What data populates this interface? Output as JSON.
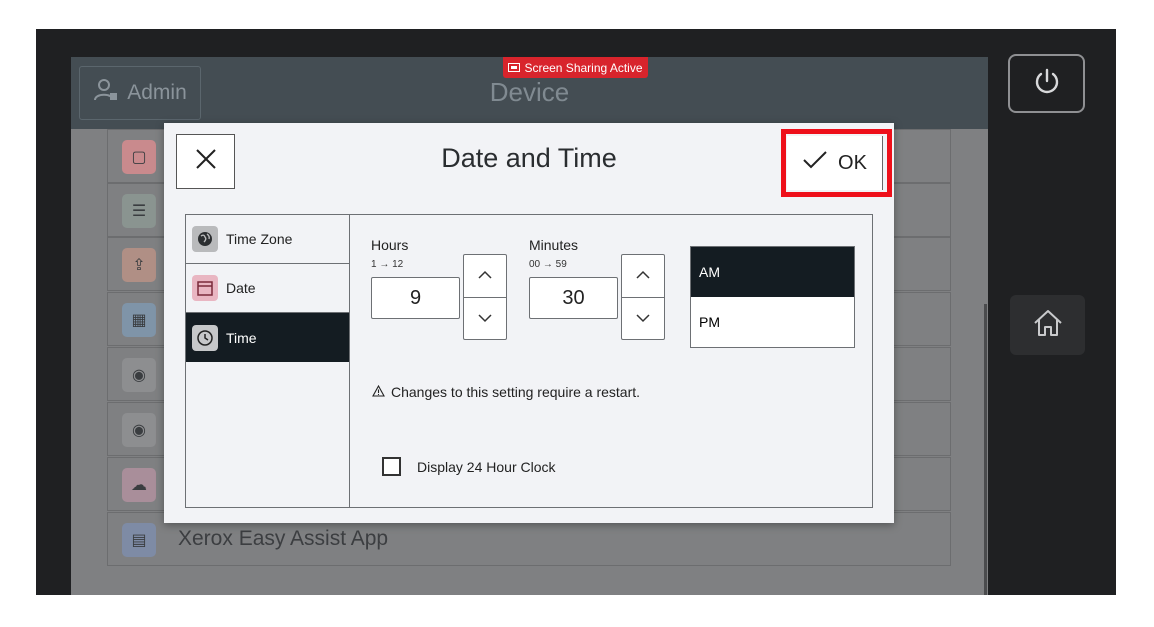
{
  "header": {
    "admin_label": "Admin",
    "title": "Device",
    "screen_share_badge": "Screen Sharing Active"
  },
  "background_list": {
    "rows": [
      {
        "label": "",
        "icon": "app-icon",
        "color": "#c98a8d"
      },
      {
        "label": "",
        "icon": "list-icon",
        "color": "#8a9490"
      },
      {
        "label": "",
        "icon": "upload-box-icon",
        "color": "#b08f85"
      },
      {
        "label": "",
        "icon": "calculator-icon",
        "color": "#7f94a8"
      },
      {
        "label": "",
        "icon": "dial-icon",
        "color": "#8d8e90"
      },
      {
        "label": "",
        "icon": "dial-icon",
        "color": "#8d8e90"
      },
      {
        "label": "",
        "icon": "cloud-upload-icon",
        "color": "#a98e9a"
      },
      {
        "label": "Xerox Easy Assist App",
        "icon": "document-icon",
        "color": "#7e8ba5"
      }
    ]
  },
  "dialog": {
    "title": "Date and Time",
    "ok_label": "OK",
    "nav": [
      {
        "label": "Time Zone",
        "icon": "globe-icon",
        "active": false
      },
      {
        "label": "Date",
        "icon": "calendar-icon",
        "active": false
      },
      {
        "label": "Time",
        "icon": "clock-icon",
        "active": true
      }
    ],
    "hours": {
      "label": "Hours",
      "range": "1 → 12",
      "value": "9"
    },
    "minutes": {
      "label": "Minutes",
      "range": "00 → 59",
      "value": "30"
    },
    "am_label": "AM",
    "pm_label": "PM",
    "selected_period": "AM",
    "restart_note": "Changes to this setting require a restart.",
    "clock24_label": "Display 24 Hour Clock",
    "clock24_checked": false
  },
  "colors": {
    "accent_red": "#ee0f1a",
    "selected_dark": "#141c22"
  }
}
